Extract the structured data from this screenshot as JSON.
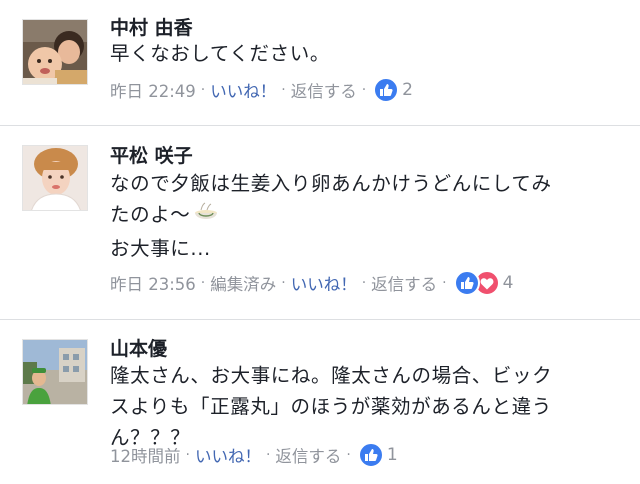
{
  "colors": {
    "text": "#1d2129",
    "meta": "#90949c",
    "like_link": "#4267b2",
    "like_reaction": "#3b7cf0",
    "love_reaction": "#f0506e",
    "divider": "#dddfe2"
  },
  "comments": [
    {
      "author": "中村 由香",
      "lines": [
        "早くなおしてください。"
      ],
      "timestamp": "昨日 22:49",
      "edited_label": "",
      "like_label": "いいね！",
      "reply_label": "返信する",
      "reactions": [
        "like-icon"
      ],
      "reaction_count": "2"
    },
    {
      "author": "平松 咲子",
      "lines": [
        "なので夕飯は生姜入り卵あんかけうどんにしてみ",
        "たのよ〜",
        "お大事に..."
      ],
      "emoji": "noodle-bowl-icon",
      "timestamp": "昨日 23:56",
      "edited_label": "編集済み",
      "like_label": "いいね！",
      "reply_label": "返信する",
      "reactions": [
        "like-icon",
        "love-icon"
      ],
      "reaction_count": "4"
    },
    {
      "author": "山本優",
      "lines": [
        "隆太さん、お大事にね。隆太さんの場合、ビック",
        "スよりも「正露丸」のほうが薬効があるんと違う",
        "ん？？？"
      ],
      "timestamp": "12時間前",
      "edited_label": "",
      "like_label": "いいね！",
      "reply_label": "返信する",
      "reactions": [
        "like-icon"
      ],
      "reaction_count": "1"
    }
  ]
}
